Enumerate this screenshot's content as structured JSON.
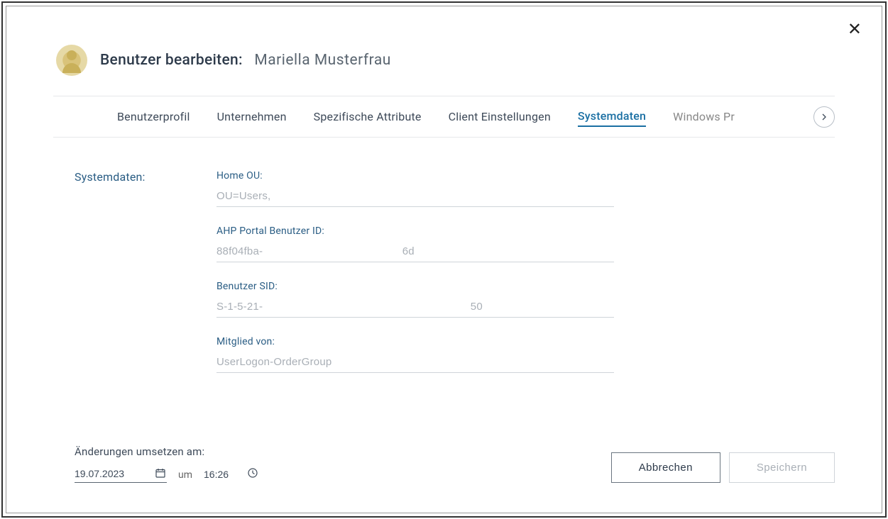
{
  "dialog": {
    "title_prefix": "Benutzer bearbeiten:",
    "title_name": "Mariella Musterfrau"
  },
  "tabs": {
    "items": [
      "Benutzerprofil",
      "Unternehmen",
      "Spezifische Attribute",
      "Client Einstellungen",
      "Systemdaten",
      "Windows Pr"
    ],
    "active_index": 4
  },
  "section": {
    "label": "Systemdaten:"
  },
  "fields": {
    "home_ou": {
      "label": "Home OU:",
      "value": "OU=Users,                                                                     "
    },
    "portal_id": {
      "label": "AHP Portal Benutzer ID:",
      "value": "88f04fba-                                             6d"
    },
    "sid": {
      "label": "Benutzer SID:",
      "value": "S-1-5-21-                                                                   50"
    },
    "member_of": {
      "label": "Mitglied von:",
      "value": "UserLogon-OrderGroup"
    }
  },
  "schedule": {
    "label": "Änderungen umsetzen am:",
    "date": "19.07.2023",
    "um": "um",
    "time": "16:26"
  },
  "actions": {
    "cancel": "Abbrechen",
    "save": "Speichern"
  }
}
